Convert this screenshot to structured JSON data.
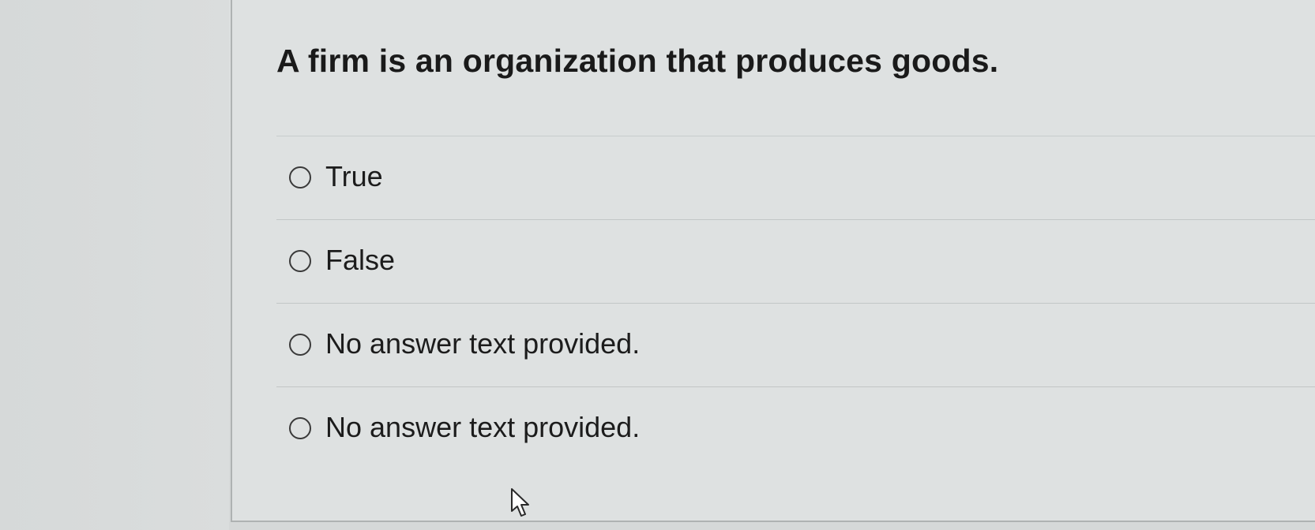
{
  "question": {
    "text": "A firm is an organization that produces goods."
  },
  "options": [
    {
      "label": "True",
      "selected": false
    },
    {
      "label": "False",
      "selected": false
    },
    {
      "label": "No answer text provided.",
      "selected": false
    },
    {
      "label": "No answer text provided.",
      "selected": false
    }
  ],
  "colors": {
    "background": "#d9dcdc",
    "text": "#1a1a1a",
    "divider": "#c2c6c6"
  },
  "icons": {
    "radio": "radio-unselected-icon",
    "cursor": "mouse-pointer-icon"
  }
}
